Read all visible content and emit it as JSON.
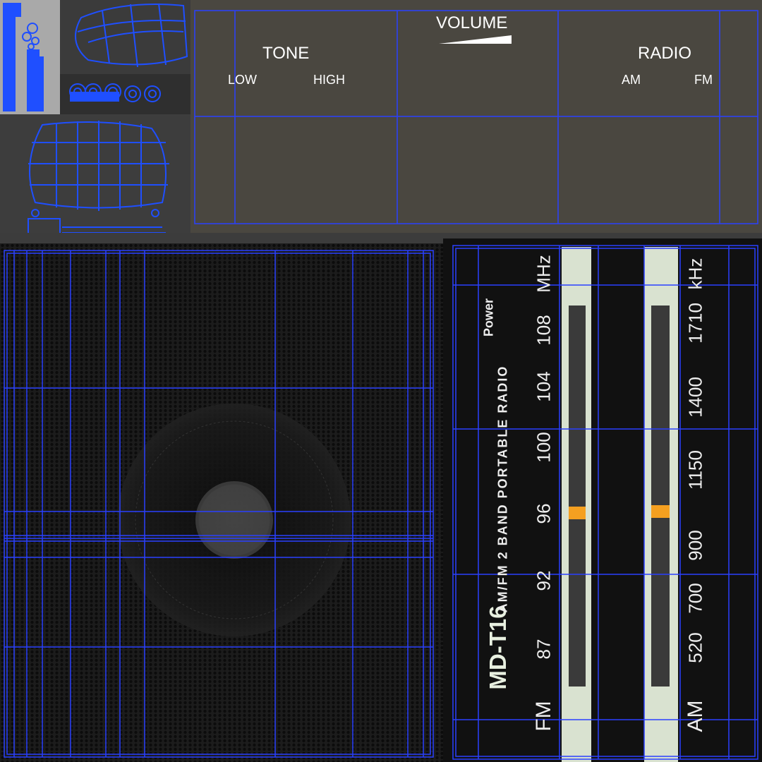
{
  "control_panel": {
    "tone_label": "TONE",
    "tone_low": "LOW",
    "tone_high": "HIGH",
    "volume_label": "VOLUME",
    "radio_label": "RADIO",
    "radio_am": "AM",
    "radio_fm": "FM"
  },
  "dial": {
    "power_label": "Power",
    "model": "MD-T16",
    "description": "AM/FM 2 BAND PORTABLE RADIO",
    "fm_band": "FM",
    "fm_unit": "MHz",
    "fm_scale": [
      "87",
      "92",
      "96",
      "100",
      "104",
      "108"
    ],
    "am_band": "AM",
    "am_unit": "kHz",
    "am_scale": [
      "520",
      "700",
      "900",
      "1150",
      "1400",
      "1710"
    ]
  },
  "colors": {
    "wireframe": "#1f4fff",
    "panel": "#4a4740",
    "indicator": "#f5a020"
  },
  "icons": [
    "radio-wireframe-icon",
    "speaker-cone-icon",
    "knob-icon"
  ]
}
